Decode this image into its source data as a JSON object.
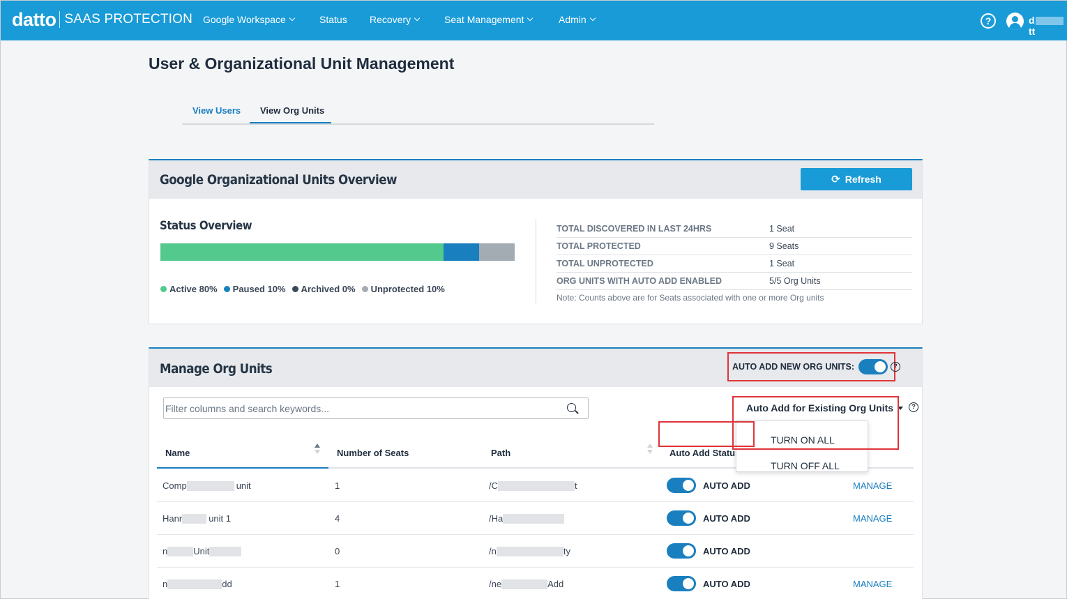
{
  "colors": {
    "brand_blue": "#199bd8",
    "link_blue": "#1a7fbf",
    "highlight_red": "#e0333a",
    "active": "#54c98d",
    "paused": "#1a7fbf",
    "archived": "#3a4a5a",
    "unprotected": "#a3abb3"
  },
  "app": {
    "brand": "datto",
    "product": "SAAS PROTECTION"
  },
  "nav": {
    "items": [
      {
        "label": "Google Workspace",
        "has_menu": true
      },
      {
        "label": "Status",
        "has_menu": false
      },
      {
        "label": "Recovery",
        "has_menu": true
      },
      {
        "label": "Seat Management",
        "has_menu": true
      },
      {
        "label": "Admin",
        "has_menu": true
      }
    ],
    "help_glyph": "?",
    "user_initial": "d",
    "user_suffix": "tt"
  },
  "page": {
    "title": "User & Organizational Unit Management"
  },
  "tabs": {
    "users": "View Users",
    "org_units": "View Org Units",
    "active": "org_units"
  },
  "overview": {
    "title": "Google Organizational Units Overview",
    "refresh_label": "Refresh",
    "status_title": "Status Overview",
    "status": {
      "active_pct": 80,
      "paused_pct": 10,
      "archived_pct": 0,
      "unprotected_pct": 10,
      "legend": [
        "Active 80%",
        "Paused 10%",
        "Archived 0%",
        "Unprotected 10%"
      ]
    },
    "stats": [
      {
        "label": "TOTAL DISCOVERED IN LAST 24HRS",
        "value": "1 Seat"
      },
      {
        "label": "TOTAL PROTECTED",
        "value": "9 Seats"
      },
      {
        "label": "TOTAL UNPROTECTED",
        "value": "1 Seat"
      },
      {
        "label": "ORG UNITS WITH AUTO ADD ENABLED",
        "value": "5/5 Org Units"
      }
    ],
    "note": "Note: Counts above are for Seats associated with one or more Org units"
  },
  "manage": {
    "title": "Manage Org Units",
    "auto_add_new_label": "AUTO ADD NEW ORG UNITS:",
    "auto_add_new_on": true,
    "search_placeholder": "Filter columns and search keywords...",
    "bulk_dropdown_label": "Auto Add for Existing Org Units",
    "bulk_menu": [
      "TURN ON ALL",
      "TURN OFF ALL"
    ],
    "columns": {
      "name": "Name",
      "seats": "Number of Seats",
      "path": "Path",
      "auto_add": "Auto Add Status"
    },
    "rows": [
      {
        "name_start": "Comp",
        "name_end": "unit",
        "seats": "1",
        "path_start": "/C",
        "path_end": "t",
        "status": "AUTO ADD",
        "on": true,
        "manage": "MANAGE"
      },
      {
        "name_start": "Hanr",
        "name_end": "unit 1",
        "seats": "4",
        "path_start": "/Ha",
        "path_end": "",
        "status": "AUTO ADD",
        "on": true,
        "manage": "MANAGE"
      },
      {
        "name_start": "n",
        "name_end": "Unit",
        "seats": "0",
        "path_start": "/n",
        "path_end": "ty",
        "status": "AUTO ADD",
        "on": true,
        "manage": ""
      },
      {
        "name_start": "n",
        "name_end": "dd",
        "seats": "1",
        "path_start": "/ne",
        "path_end": "Add",
        "status": "AUTO ADD",
        "on": true,
        "manage": "MANAGE"
      }
    ]
  }
}
